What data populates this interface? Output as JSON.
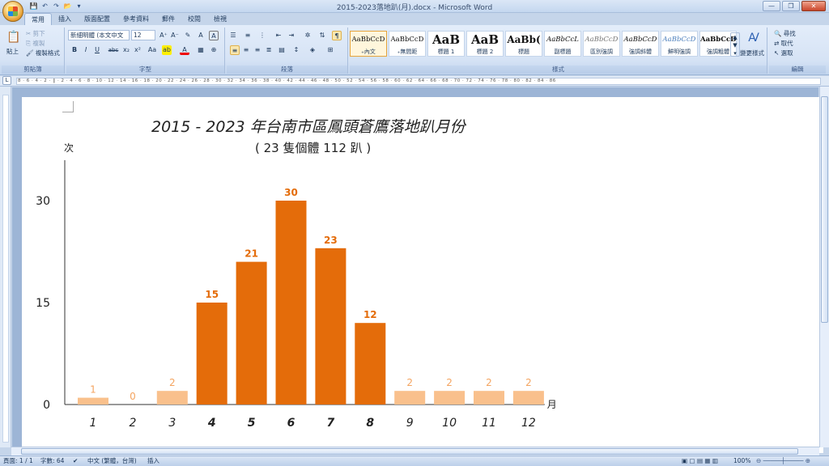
{
  "window": {
    "title": "2015-2023落地趴(月).docx - Microsoft Word",
    "min_label": "—",
    "max_label": "❐",
    "close_label": "✕"
  },
  "quick_access": [
    "💾",
    "↶",
    "↷",
    "📂",
    "▾"
  ],
  "tabs": [
    "常用",
    "插入",
    "版面配置",
    "參考資料",
    "郵件",
    "校閱",
    "檢視"
  ],
  "ribbon": {
    "clipboard": {
      "paste": "貼上",
      "cut": "剪下",
      "copy": "複製",
      "format_painter": "複製格式",
      "title": "剪貼簿"
    },
    "font": {
      "font_name": "新細明體 (本文中文",
      "font_size": "12",
      "title": "字型",
      "bold": "B",
      "italic": "I",
      "underline": "U",
      "strike": "abc",
      "sub": "x₂",
      "sup": "x²",
      "aa": "Aa",
      "grow": "A⁺",
      "shrink": "A⁻",
      "clear": "A",
      "phon": "A"
    },
    "paragraph": {
      "title": "段落"
    },
    "styles": {
      "title": "樣式",
      "items": [
        {
          "sample": "AaBbCcD",
          "name": "₊內文"
        },
        {
          "sample": "AaBbCcD",
          "name": "₊無間距"
        },
        {
          "sample": "AaB",
          "name": "標題 1"
        },
        {
          "sample": "AaB",
          "name": "標題 2"
        },
        {
          "sample": "AaBb(",
          "name": "標題"
        },
        {
          "sample": "AaBbCcL",
          "name": "副標題"
        },
        {
          "sample": "AaBbCcD",
          "name": "區別強調"
        },
        {
          "sample": "AaBbCcD",
          "name": "強調斜體"
        },
        {
          "sample": "AaBbCcD",
          "name": "鮮明強調"
        },
        {
          "sample": "AaBbCcD",
          "name": "強調粗體"
        }
      ],
      "change_styles": "變更樣式"
    },
    "editing": {
      "find": "尋找",
      "replace": "取代",
      "select": "選取",
      "title": "編輯"
    }
  },
  "ruler_ticks": "8 · 6 · 4 · 2 · ║ · 2 · 4 · 6 · 8 · 10 · 12 · 14 · 16 · 18 · 20 · 22 · 24 · 26 · 28 · 30 · 32 · 34 · 36 · 38 · 40 · 42 · 44 · 46 · 48 · 50 · 52 · 54 · 56 · 58 · 60 · 62 · 64 · 66 · 68 · 70 · 72 · 74 · 76 · 78 · 80 · 82 · 84 · 86",
  "status": {
    "page": "頁面: 1 / 1",
    "words": "字數: 64",
    "language": "中文 (繁體，台灣)",
    "mode": "插入",
    "zoom": "100%"
  },
  "chart_data": {
    "type": "bar",
    "title": "2015 - 2023 年台南市區鳳頭蒼鷹落地趴月份",
    "subtitle": "( 23 隻個體 112 趴 )",
    "ylabel": "次",
    "xlabel": "月",
    "categories": [
      "1",
      "2",
      "3",
      "4",
      "5",
      "6",
      "7",
      "8",
      "9",
      "10",
      "11",
      "12"
    ],
    "values": [
      1,
      0,
      2,
      15,
      21,
      30,
      23,
      12,
      2,
      2,
      2,
      2
    ],
    "highlight": [
      false,
      false,
      false,
      true,
      true,
      true,
      true,
      true,
      false,
      false,
      false,
      false
    ],
    "yticks": [
      0,
      15,
      30
    ],
    "ylim": [
      0,
      35
    ],
    "colors": {
      "highlight": "#e46c0a",
      "normal": "#f9c08c",
      "label_normal": "#f4a460"
    },
    "grid": false
  }
}
